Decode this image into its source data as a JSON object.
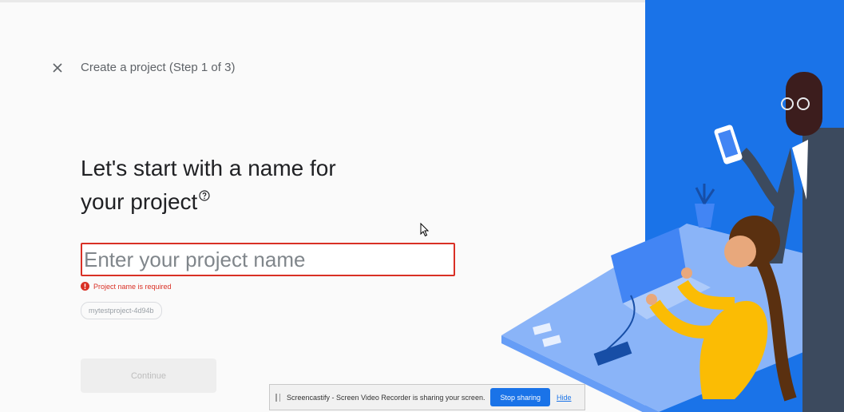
{
  "header": {
    "step_title": "Create a project (Step 1 of 3)",
    "close_icon": "close-icon"
  },
  "main": {
    "heading_line1": "Let's start with a name for",
    "heading_line2": "your project",
    "help_icon": "help-circle-icon",
    "project_name_input": {
      "value": "",
      "placeholder": "Enter your project name"
    },
    "error_message": "Project name is required",
    "project_id_chip": "mytestproject-4d94b",
    "continue_label": "Continue"
  },
  "screen_share_bar": {
    "message": "Screencastify - Screen Video Recorder is sharing your screen.",
    "stop_label": "Stop sharing",
    "hide_label": "Hide"
  },
  "colors": {
    "accent": "#1a73e8",
    "error": "#d93025",
    "text_primary": "#202124",
    "text_secondary": "#5f6368"
  }
}
